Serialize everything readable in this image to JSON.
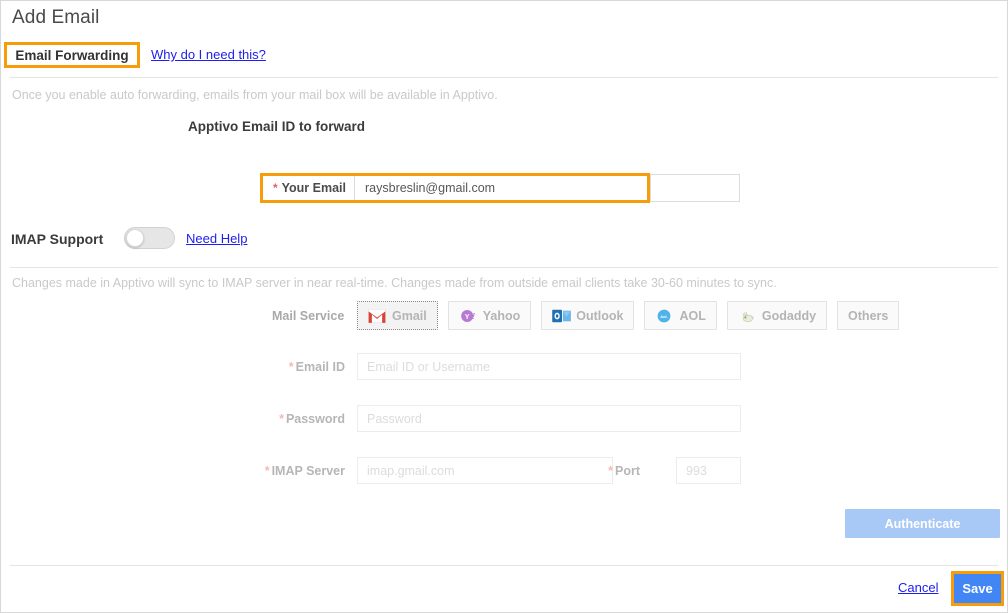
{
  "header": {
    "title": "Add Email"
  },
  "tabs": {
    "active_label": "Email Forwarding",
    "help_link": "Why do I need this?",
    "highlight_color": "#f79c0a"
  },
  "forwarding": {
    "note": "Once you enable auto forwarding, emails from your mail box will be available in Apptivo.",
    "section_heading": "Apptivo Email ID to forward",
    "your_email": {
      "required_mark": "*",
      "label": "Your Email",
      "value": "raysbreslin@gmail.com"
    }
  },
  "imap": {
    "label": "IMAP Support",
    "toggle_state": "off",
    "need_help_link": "Need Help",
    "sync_note": "Changes made in Apptivo will sync to IMAP server in near real-time. Changes made from outside email clients take 30-60 minutes to sync.",
    "mail_service": {
      "label": "Mail Service",
      "selected": "Gmail",
      "options": [
        {
          "name": "Gmail",
          "icon": "gmail-icon"
        },
        {
          "name": "Yahoo",
          "icon": "yahoo-icon"
        },
        {
          "name": "Outlook",
          "icon": "outlook-icon"
        },
        {
          "name": "AOL",
          "icon": "aol-icon"
        },
        {
          "name": "Godaddy",
          "icon": "godaddy-icon"
        },
        {
          "name": "Others",
          "icon": "none"
        }
      ]
    },
    "fields": {
      "email_id": {
        "required_mark": "*",
        "label": "Email ID",
        "value": "",
        "placeholder": "Email ID or Username"
      },
      "password": {
        "required_mark": "*",
        "label": "Password",
        "value": "",
        "placeholder": "Password"
      },
      "imap_server": {
        "required_mark": "*",
        "label": "IMAP Server",
        "value": "",
        "placeholder": "imap.gmail.com"
      },
      "port": {
        "required_mark": "*",
        "label": "Port",
        "value": "",
        "placeholder": "993"
      }
    },
    "authenticate_label": "Authenticate"
  },
  "footer": {
    "cancel_label": "Cancel",
    "save_label": "Save",
    "save_highlight_color": "#f79c0a",
    "save_color": "#4285f4"
  }
}
